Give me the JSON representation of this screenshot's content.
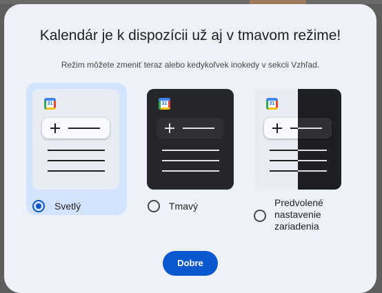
{
  "dialog": {
    "title": "Kalendár je k dispozícii už aj v tmavom režime!",
    "subtitle": "Režim môžete zmeniť teraz alebo kedykoľvek inokedy v sekcii Vzhľad.",
    "calendar_icon_number": "31",
    "options": [
      {
        "label": "Svetlý",
        "selected": true,
        "preview": "light"
      },
      {
        "label": "Tmavý",
        "selected": false,
        "preview": "dark"
      },
      {
        "label_lines": [
          "Predvolené",
          "nastavenie",
          "zariadenia"
        ],
        "selected": false,
        "preview": "device"
      }
    ],
    "ok_label": "Dobre"
  },
  "colors": {
    "accent": "#0b57d0",
    "selected_bg": "#d3e3fd",
    "dialog_bg": "#eef2f8",
    "dark_preview": "#26272b"
  },
  "icons": [
    "google-calendar-icon",
    "plus-icon",
    "radio-button"
  ]
}
